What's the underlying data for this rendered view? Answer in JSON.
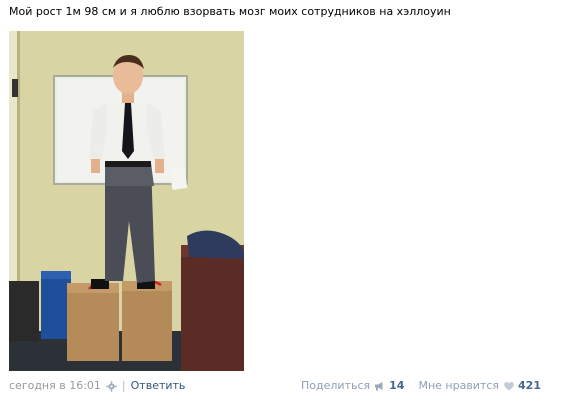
{
  "post": {
    "text": "Мой рост 1м 98 см и я люблю взорвать мозг моих сотрудников на хэллоуин",
    "photo": {
      "icon": "photo-man-standing-on-boxes"
    },
    "footer": {
      "timestamp": "сегодня в 16:01",
      "separator": "|",
      "reply_label": "Ответить",
      "share_label": "Поделиться",
      "share_count": "14",
      "like_label": "Мне нравится",
      "like_count": "421"
    }
  },
  "colors": {
    "link": "#2b587a",
    "muted": "#999999",
    "action": "#8fa1b3",
    "count": "#45688e"
  }
}
